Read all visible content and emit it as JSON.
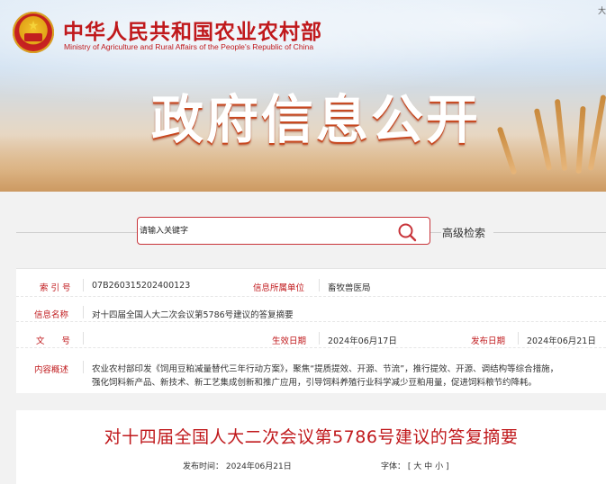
{
  "header": {
    "ministry_cn": "中华人民共和国农业农村部",
    "ministry_en": "Ministry of Agriculture and Rural Affairs of the People's Republic of China",
    "section_title": "政府信息公开",
    "corner_char": "大"
  },
  "search": {
    "placeholder": "请输入关键字",
    "value": "",
    "advanced_label": "高级检索"
  },
  "info": {
    "index_label": "索 引 号",
    "index_value": "07B260315202400123",
    "org_label": "信息所属单位",
    "org_value": "畜牧兽医局",
    "name_label": "信息名称",
    "name_value": "对十四届全国人大二次会议第5786号建议的答复摘要",
    "docno_label": "文　　号",
    "docno_value": "",
    "created_label": "生效日期",
    "created_value": "2024年06月17日",
    "published_label": "发布日期",
    "published_value": "2024年06月21日",
    "summary_label": "内容概述",
    "summary_lines": [
      "农业农村部印发《饲用豆粕减量替代三年行动方案》，聚焦“提质提效、开源、节流”，推行提效、开源、调结构等综合措施，",
      "强化饲料新产品、新技术、新工艺集成创新和推广应用，引导饲料养殖行业科学减少豆粕用量，促进饲料粮节约降耗。"
    ]
  },
  "document": {
    "title": "对十四届全国人大二次会议第5786号建议的答复摘要",
    "publish_label": "发布时间：",
    "publish_date": "2024年06月21日",
    "font_label": "字体：",
    "font_open": "[",
    "font_large": "大",
    "font_medium": "中",
    "font_small": "小",
    "font_close": "]"
  },
  "colors": {
    "accent_red": "#c0191c",
    "search_border": "#c8343a",
    "title_shadow": "#c84820"
  }
}
